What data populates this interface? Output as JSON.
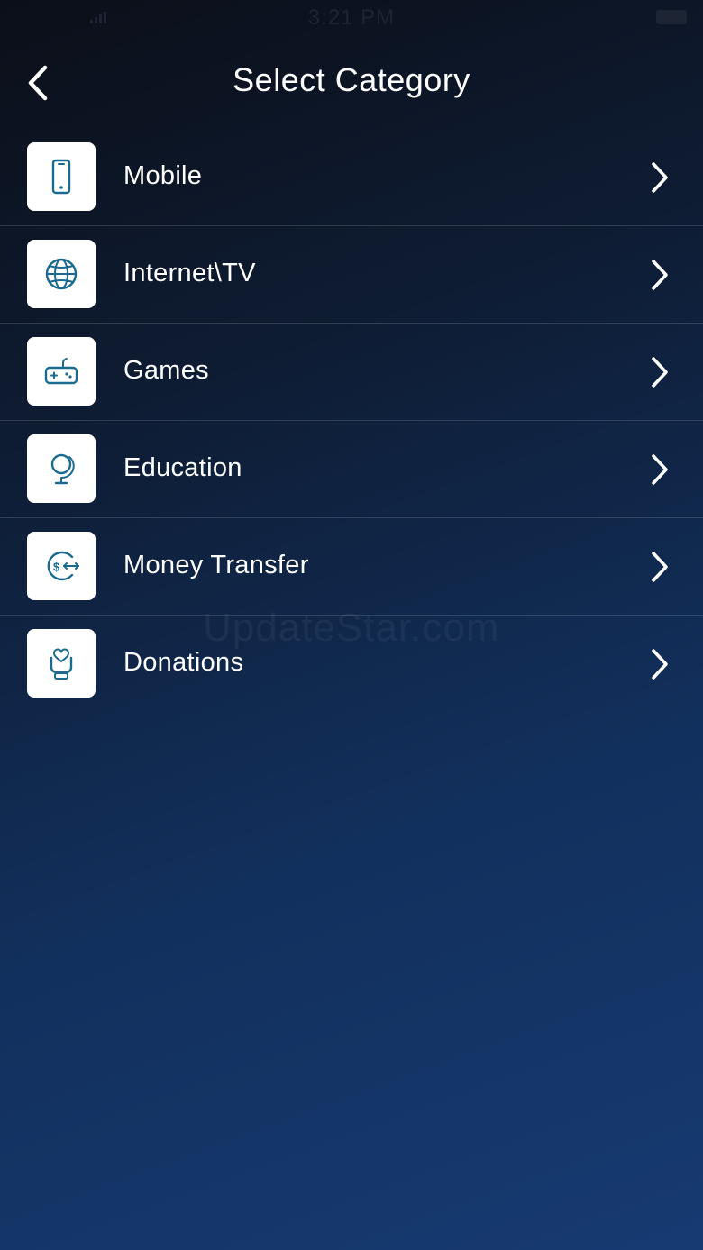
{
  "status_bar": {
    "time": "3:21 PM"
  },
  "header": {
    "title": "Select Category",
    "back_icon": "chevron-left-icon"
  },
  "categories": [
    {
      "label": "Mobile",
      "icon": "mobile-phone-icon"
    },
    {
      "label": "Internet\\TV",
      "icon": "globe-icon"
    },
    {
      "label": "Games",
      "icon": "gamepad-icon"
    },
    {
      "label": "Education",
      "icon": "globe-stand-icon"
    },
    {
      "label": "Money Transfer",
      "icon": "money-transfer-icon"
    },
    {
      "label": "Donations",
      "icon": "heart-hand-icon"
    }
  ],
  "watermark": "UpdateStar.com",
  "colors": {
    "icon_accent": "#1a6b8f",
    "tile_background": "#ffffff",
    "text": "#ffffff",
    "background_top": "#0b0f18",
    "background_bottom": "#163a72"
  }
}
